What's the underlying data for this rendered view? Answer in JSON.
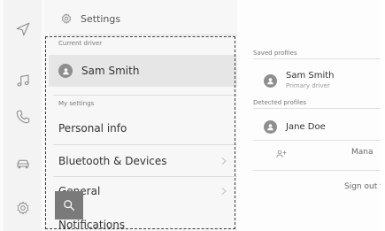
{
  "header": {
    "title": "Settings"
  },
  "settings_list": {
    "current_driver_label": "Current driver",
    "current_driver_name": "Sam Smith",
    "my_settings_label": "My settings",
    "items": [
      {
        "label": "Personal info"
      },
      {
        "label": "Bluetooth & Devices"
      },
      {
        "label": "General"
      },
      {
        "label": "Notifications"
      }
    ]
  },
  "profiles": {
    "saved_label": "Saved profiles",
    "saved": [
      {
        "name": "Sam Smith",
        "subtitle": "Primary driver"
      }
    ],
    "detected_label": "Detected profiles",
    "detected": [
      {
        "name": "Jane Doe"
      }
    ],
    "manage_label": "Mana",
    "signout_label": "Sign out t"
  },
  "rail_icons": [
    "navigation-icon",
    "music-icon",
    "phone-icon",
    "car-icon",
    "settings-icon"
  ],
  "search_button": {
    "icon": "search-icon"
  },
  "colors": {
    "selected_row": "#e6e6e6",
    "avatar": "#8e8e8e",
    "fab": "#7a7a7a",
    "frame": "#3a3a3a"
  }
}
